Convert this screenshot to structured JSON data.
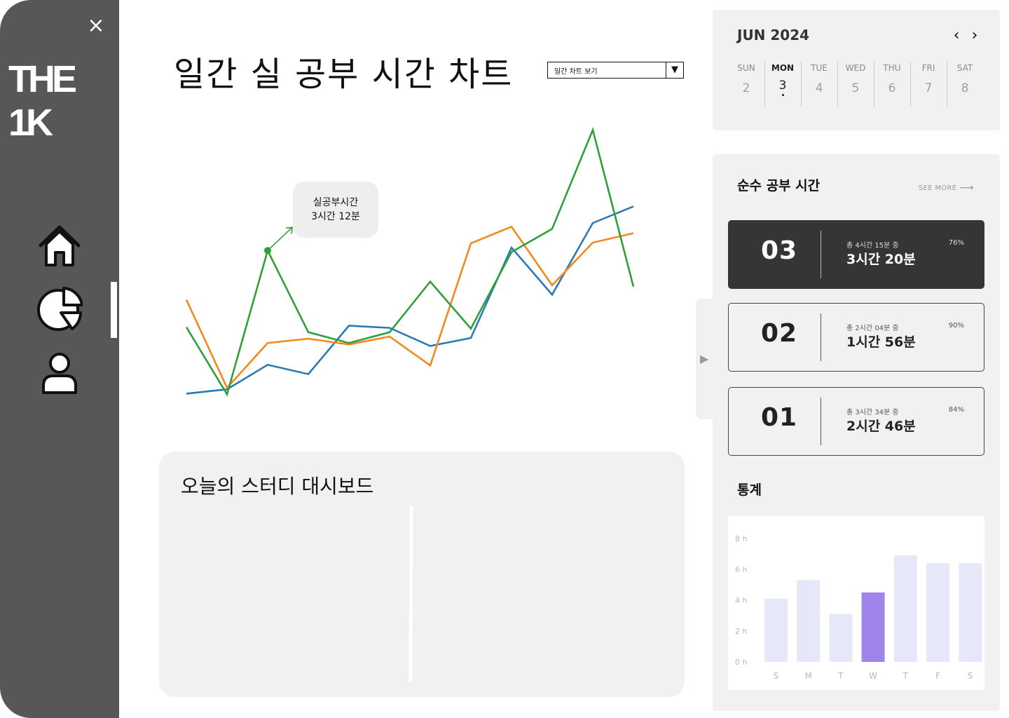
{
  "sidebar": {
    "close_icon": "×",
    "logo": "THE 1K",
    "nav": [
      {
        "name": "home",
        "icon": "home-icon"
      },
      {
        "name": "chart",
        "icon": "pie-chart-icon",
        "active": true
      },
      {
        "name": "profile",
        "icon": "user-icon"
      }
    ]
  },
  "header": {
    "title": "일간 실 공부 시간 차트",
    "select_value": "일간 차트 보기",
    "select_arrow": "▼"
  },
  "chart_data": {
    "type": "line",
    "x": [
      1,
      2,
      3,
      4,
      5,
      6,
      7,
      8,
      9,
      10,
      11,
      12
    ],
    "series": [
      {
        "color": "#2a7ab8",
        "values": [
          0.0,
          0.6,
          4.0,
          2.7,
          9.4,
          9.1,
          6.6,
          7.7,
          20.2,
          13.7,
          23.6,
          25.9
        ]
      },
      {
        "color": "#f5871f",
        "values": [
          13.0,
          0.8,
          7.0,
          7.6,
          6.8,
          7.9,
          3.9,
          20.8,
          23.1,
          15.0,
          20.9,
          22.2
        ]
      },
      {
        "color": "#2fa037",
        "values": [
          9.2,
          -0.1,
          19.8,
          8.5,
          7.0,
          8.5,
          15.5,
          9.0,
          19.6,
          22.8,
          36.5,
          14.8
        ]
      }
    ],
    "tooltip": {
      "series_index": 2,
      "point_index": 2,
      "lines": [
        "실공부시간",
        "3시간 12분"
      ]
    },
    "grid": false
  },
  "dashboard": {
    "title": "오늘의 스터디 대시보드"
  },
  "calendar": {
    "month": "JUN 2024",
    "prev_icon": "‹",
    "next_icon": "›",
    "days": [
      {
        "dow": "SUN",
        "num": "2"
      },
      {
        "dow": "MON",
        "num": "3",
        "active": true
      },
      {
        "dow": "TUE",
        "num": "4"
      },
      {
        "dow": "WED",
        "num": "5"
      },
      {
        "dow": "THU",
        "num": "6"
      },
      {
        "dow": "FRI",
        "num": "7"
      },
      {
        "dow": "SAT",
        "num": "8"
      }
    ]
  },
  "panel": {
    "collapse_icon": "▶",
    "title": "순수 공부 시간",
    "see_more": "SEE MORE",
    "see_more_arrow": "⟶",
    "cards": [
      {
        "rank": "03",
        "total": "총 4시간 15분 중",
        "actual": "3시간 20분",
        "pct": "76%",
        "dark": true
      },
      {
        "rank": "02",
        "total": "총 2시간 04분 중",
        "actual": "1시간 56분",
        "pct": "90%",
        "dark": false
      },
      {
        "rank": "01",
        "total": "총 3시간 34분 중",
        "actual": "2시간 46분",
        "pct": "84%",
        "dark": false
      }
    ],
    "stats_title": "통계",
    "stats_chart": {
      "type": "bar",
      "y_ticks": [
        "0 h",
        "2 h",
        "4 h",
        "6 h",
        "8 h"
      ],
      "categories": [
        "S",
        "M",
        "T",
        "W",
        "T",
        "F",
        "S"
      ],
      "values": [
        4.1,
        5.3,
        3.1,
        4.5,
        6.9,
        6.4,
        6.4
      ],
      "highlight_index": 3,
      "bar_color": "#e6e8fa",
      "highlight_color": "#a084ea",
      "ylim": [
        0,
        8
      ]
    }
  }
}
